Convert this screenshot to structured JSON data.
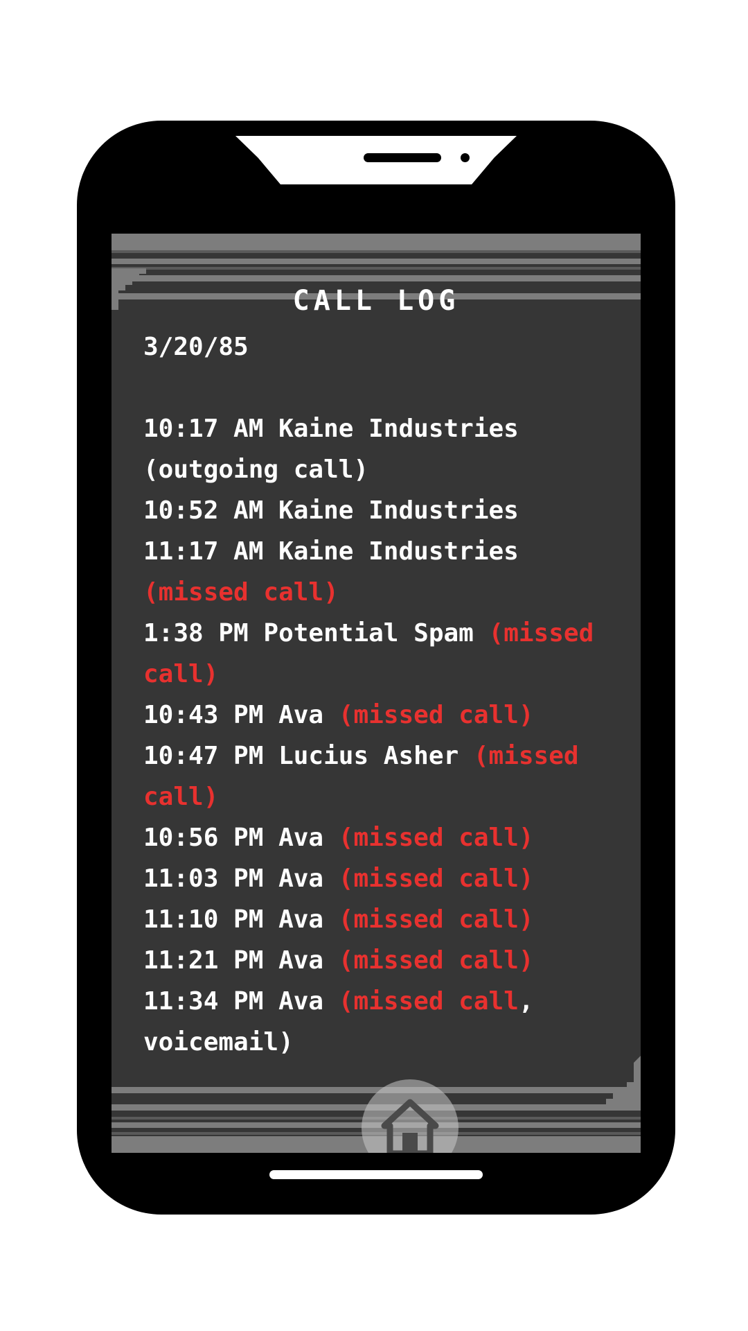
{
  "screen": {
    "title": "CALL LOG",
    "date": "3/20/85"
  },
  "calls": [
    {
      "time": "10:17 AM",
      "caller": "Kaine Industries",
      "status": "(outgoing call)",
      "status_type": "normal"
    },
    {
      "time": "10:52 AM",
      "caller": "Kaine Industries",
      "status": "",
      "status_type": "normal"
    },
    {
      "time": "11:17 AM",
      "caller": "Kaine Industries",
      "status": "(missed call)",
      "status_type": "missed"
    },
    {
      "time": "1:38 PM",
      "caller": "Potential Spam",
      "status": "(missed call)",
      "status_type": "missed"
    },
    {
      "time": "10:43 PM",
      "caller": "Ava",
      "status": "(missed call)",
      "status_type": "missed"
    },
    {
      "time": "10:47 PM",
      "caller": "Lucius Asher",
      "status": "(missed call)",
      "status_type": "missed"
    },
    {
      "time": "10:56 PM",
      "caller": "Ava",
      "status": "(missed call)",
      "status_type": "missed"
    },
    {
      "time": "11:03 PM",
      "caller": "Ava",
      "status": "(missed call)",
      "status_type": "missed"
    },
    {
      "time": "11:10 PM",
      "caller": "Ava",
      "status": "(missed call)",
      "status_type": "missed"
    },
    {
      "time": "11:21 PM",
      "caller": "Ava",
      "status": "(missed call)",
      "status_type": "missed"
    },
    {
      "time": "11:34 PM",
      "caller": "Ava",
      "status_missed": "(missed call",
      "status_rest": ", voicemail)",
      "status_type": "missed-voicemail"
    }
  ],
  "home_button": {
    "icon": "home-icon"
  },
  "colors": {
    "screen_bg": "#363636",
    "missed": "#e8312f",
    "text": "#ffffff"
  }
}
